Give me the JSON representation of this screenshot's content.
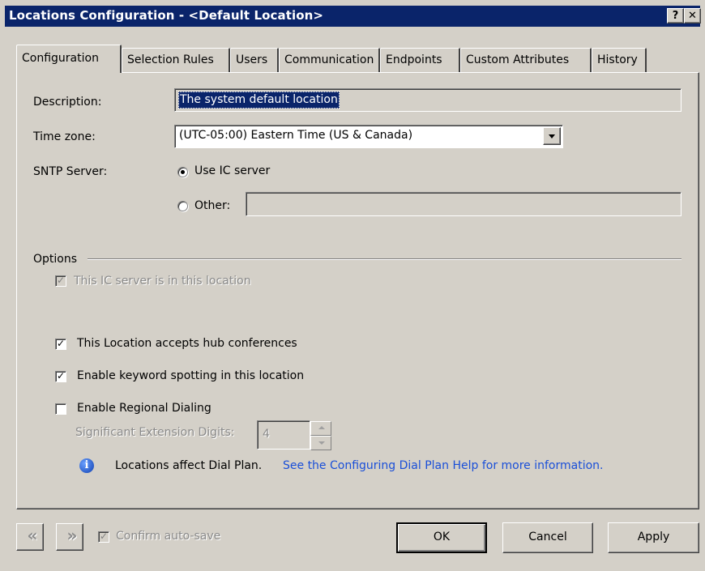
{
  "window": {
    "title": "Locations Configuration - <Default Location>",
    "help_glyph": "?",
    "close_glyph": "✕"
  },
  "tabs": [
    {
      "label": "Configuration",
      "active": true
    },
    {
      "label": "Selection Rules",
      "active": false
    },
    {
      "label": "Users",
      "active": false
    },
    {
      "label": "Communication",
      "active": false
    },
    {
      "label": "Endpoints",
      "active": false
    },
    {
      "label": "Custom Attributes",
      "active": false
    },
    {
      "label": "History",
      "active": false
    }
  ],
  "config": {
    "description_label": "Description:",
    "description_value": "The system default location",
    "timezone_label": "Time zone:",
    "timezone_value": "(UTC-05:00) Eastern Time (US & Canada)",
    "sntp_label": "SNTP Server:",
    "sntp_use_ic_label": "Use IC server",
    "sntp_other_label": "Other:",
    "sntp_other_value": "",
    "sntp_selected": "Use IC server"
  },
  "options": {
    "group_label": "Options",
    "ic_server_here": {
      "label": "This IC server is in this location",
      "checked": true,
      "enabled": false
    },
    "hub_conferences": {
      "label": "This Location accepts hub conferences",
      "checked": true
    },
    "keyword_spotting": {
      "label": "Enable keyword spotting in this location",
      "checked": true
    },
    "regional_dialing": {
      "label": "Enable Regional Dialing",
      "checked": false
    },
    "sig_ext_digits_label": "Significant Extension Digits:",
    "sig_ext_digits_value": "4",
    "info_text": "Locations affect Dial Plan.",
    "info_link": "See the Configuring Dial Plan Help for more information."
  },
  "footer": {
    "prev_glyph": "«",
    "next_glyph": "»",
    "confirm_autosave_label": "Confirm auto-save",
    "confirm_autosave_checked": true,
    "ok_label": "OK",
    "cancel_label": "Cancel",
    "apply_label": "Apply"
  },
  "icons": {
    "check_glyph": "✓",
    "info_glyph": "i"
  }
}
